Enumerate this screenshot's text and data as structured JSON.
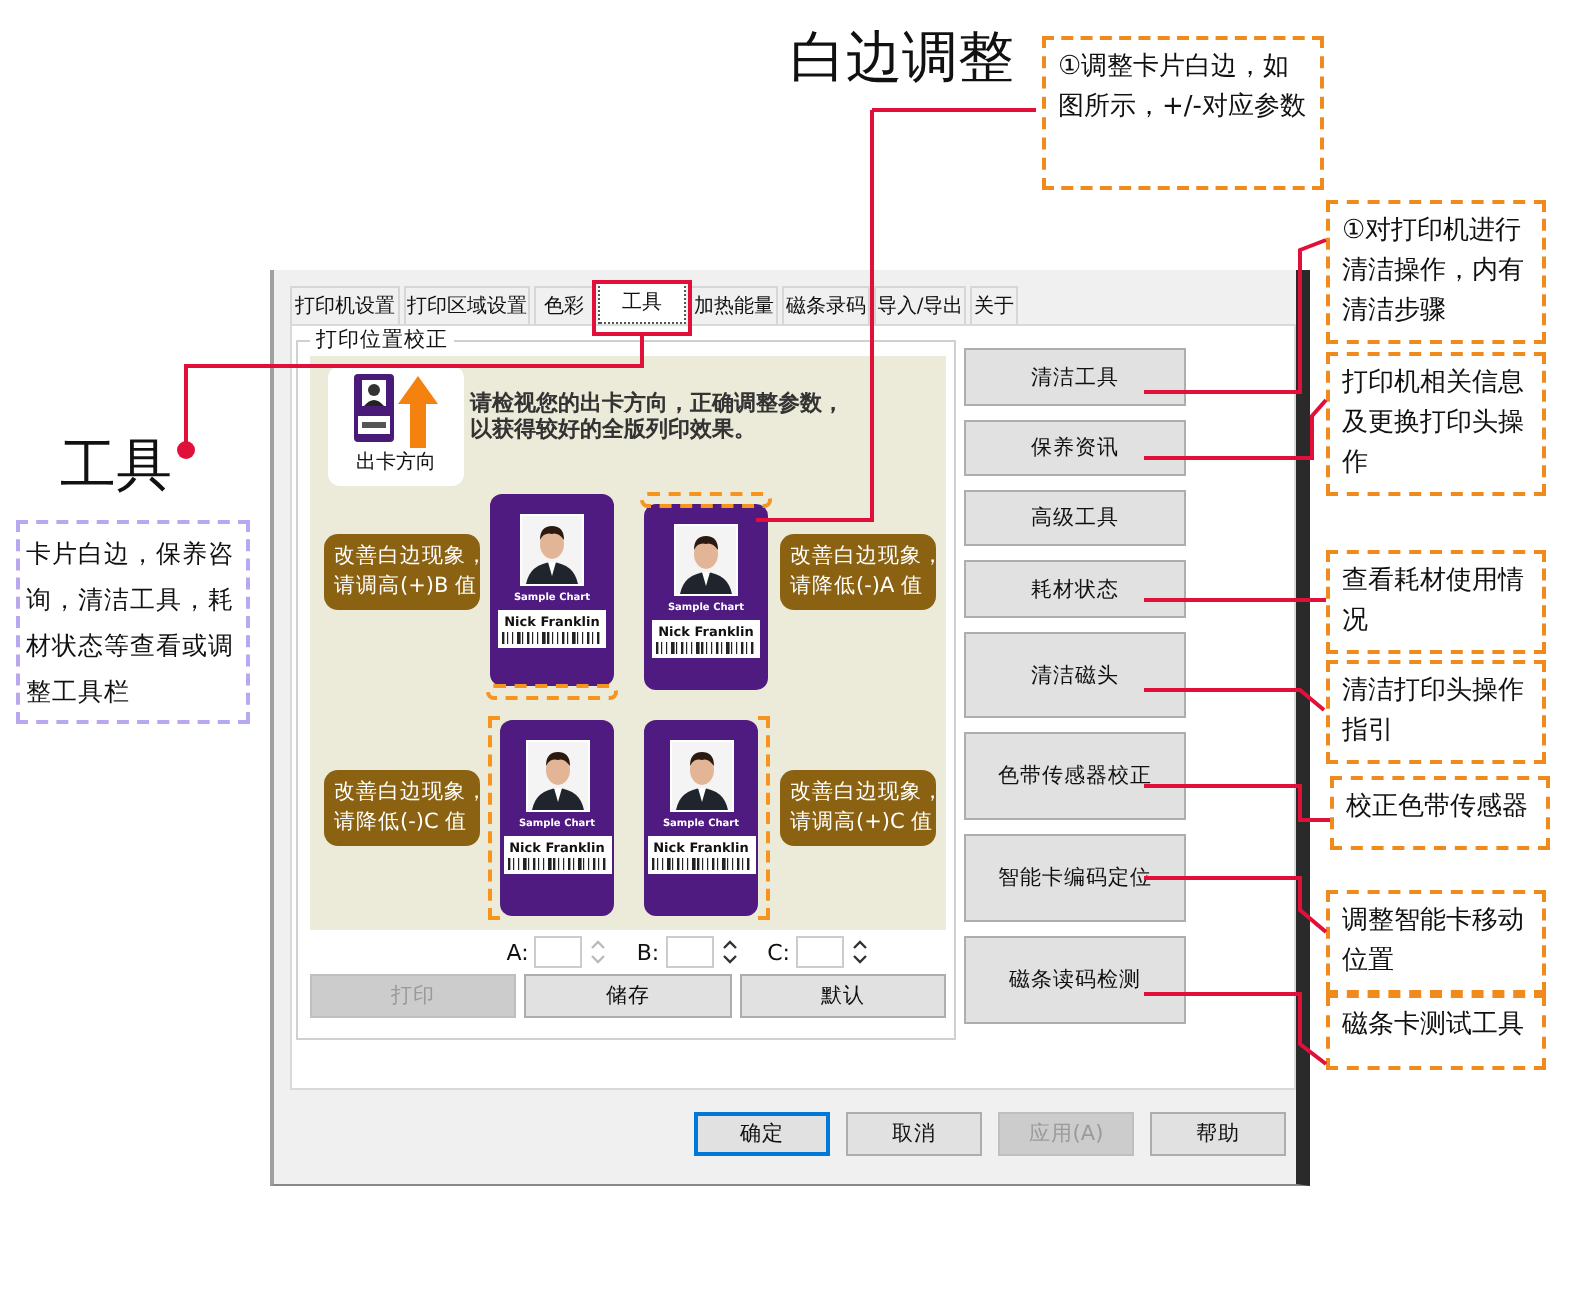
{
  "headings": [
    {
      "text": "白边调整"
    },
    {
      "text": "工具"
    }
  ],
  "notes": [
    {
      "text": "①调整卡片白边，如图所示，+/-对应参数"
    },
    {
      "text": "①对打印机进行清洁操作，内有清洁步骤"
    },
    {
      "text": "打印机相关信息及更换打印头操作"
    },
    {
      "text": "查看耗材使用情况"
    },
    {
      "text": "清洁打印头操作指引"
    },
    {
      "text": "校正色带传感器"
    },
    {
      "text": "调整智能卡移动位置"
    },
    {
      "text": "磁条卡测试工具"
    },
    {
      "text": "卡片白边，保养咨询，清洁工具，耗材状态等查看或调整工具栏"
    }
  ],
  "dialog": {
    "tabs": [
      {
        "label": "打印机设置",
        "selected": false
      },
      {
        "label": "打印区域设置",
        "selected": false
      },
      {
        "label": "色彩",
        "selected": false
      },
      {
        "label": "工具",
        "selected": true
      },
      {
        "label": "加热能量",
        "selected": false
      },
      {
        "label": "磁条录码",
        "selected": false
      },
      {
        "label": "导入/导出",
        "selected": false
      },
      {
        "label": "关于",
        "selected": false
      }
    ],
    "group_title": "打印位置校正",
    "illustration": {
      "direction_label": "出卡方向",
      "instruction": [
        "请检视您的出卡方向，正确调整参数，",
        "以获得较好的全版列印效果。"
      ],
      "bubbles": [
        [
          "改善白边现象，",
          "请调高(+)B 值"
        ],
        [
          "改善白边现象，",
          "请降低(-)A 值"
        ],
        [
          "改善白边现象，",
          "请降低(-)C 值"
        ],
        [
          "改善白边现象，",
          "请调高(+)C 值"
        ]
      ],
      "cards": [
        {
          "caption": "Sample Chart",
          "name": "Nick Franklin"
        },
        {
          "caption": "Sample Chart",
          "name": "Nick Franklin"
        },
        {
          "caption": "Sample Chart",
          "name": "Nick Franklin"
        },
        {
          "caption": "Sample Chart",
          "name": "Nick Franklin"
        }
      ]
    },
    "spinners": [
      {
        "label": "A:",
        "disabled": true
      },
      {
        "label": "B:",
        "disabled": false
      },
      {
        "label": "C:",
        "disabled": false
      }
    ],
    "actions": [
      {
        "label": "打印",
        "disabled": true
      },
      {
        "label": "储存",
        "disabled": false
      },
      {
        "label": "默认",
        "disabled": false
      }
    ],
    "tools": [
      "清洁工具",
      "保养资讯",
      "高级工具",
      "耗材状态",
      "清洁磁头",
      "色带传感器校正",
      "智能卡编码定位",
      "磁条读码检测"
    ],
    "footer": [
      {
        "label": "确定",
        "focused": true,
        "disabled": false
      },
      {
        "label": "取消",
        "focused": false,
        "disabled": false
      },
      {
        "label": "应用(A)",
        "focused": false,
        "disabled": true
      },
      {
        "label": "帮助",
        "focused": false,
        "disabled": false
      }
    ]
  }
}
